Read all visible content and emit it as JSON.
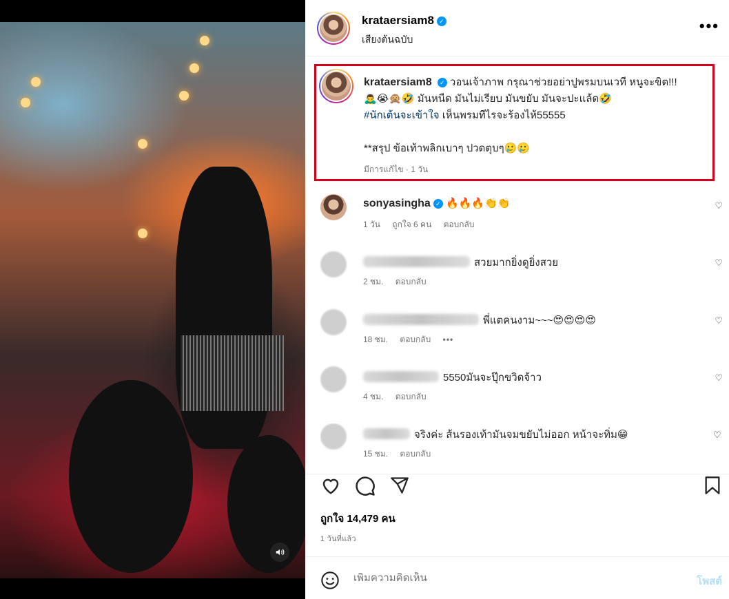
{
  "post": {
    "username": "krataersiam8",
    "audio": "เสียงต้นฉบับ",
    "caption": {
      "line1": "วอนเจ้าภาพ กรุณาช่วยอย่าปูพรมบนเวที หนูจะขิต!!!",
      "line2": "🙇‍♂️😭🙊🤣 มันหนืด มันไม่เรียบ มันขยับ มันจะปะแล้ด🤣",
      "hashtag": "#นักเต้นจะเข้าใจ",
      "line3_rest": " เห็นพรมทีไรจะร้องไห้55555",
      "line4": "**สรุป ข้อเท้าพลิกเบาๆ ปวดตุบๆ🥲🥲",
      "meta": "มีการแก้ไข · 1 วัน"
    }
  },
  "comments": [
    {
      "username": "sonyasingha",
      "text": "🔥🔥🔥👏👏",
      "time": "1 วัน",
      "likes": "ถูกใจ 6 คน",
      "reply": "ตอบกลับ"
    },
    {
      "username": "",
      "text": "สวยมากยิ่งดูยิ่งสวย",
      "time": "2 ชม.",
      "likes": "",
      "reply": "ตอบกลับ"
    },
    {
      "username": "",
      "text": "พี่แตคนงาม~~~😍😍😍😍",
      "time": "18 ชม.",
      "likes": "",
      "reply": "ตอบกลับ",
      "more": "•••"
    },
    {
      "username": "",
      "text": "5550มันจะปุ๊กขวิดจ้าว",
      "time": "4 ชม.",
      "likes": "",
      "reply": "ตอบกลับ"
    },
    {
      "username": "",
      "text": "จริงค่ะ ส้นรองเท้ามันจมขยับไม่ออก หน้าจะทิ่ม😁",
      "time": "15 ชม.",
      "likes": "",
      "reply": "ตอบกลับ"
    }
  ],
  "actions": {
    "likes": "ถูกใจ 14,479 คน",
    "time_ago": "1 วันที่แล้ว"
  },
  "add_comment": {
    "placeholder": "เพิ่มความคิดเห็น",
    "post_label": "โพสต์"
  },
  "icons": {
    "verified": "verified-badge-icon",
    "more": "more-options-icon",
    "heart": "heart-icon",
    "comment": "comment-icon",
    "share": "share-icon",
    "save": "bookmark-icon",
    "emoji": "emoji-icon",
    "mute": "speaker-icon"
  },
  "colors": {
    "highlight": "#d0021b",
    "verified": "#0095f6",
    "hashtag": "#00376b",
    "post_disabled": "#b2dffc"
  }
}
